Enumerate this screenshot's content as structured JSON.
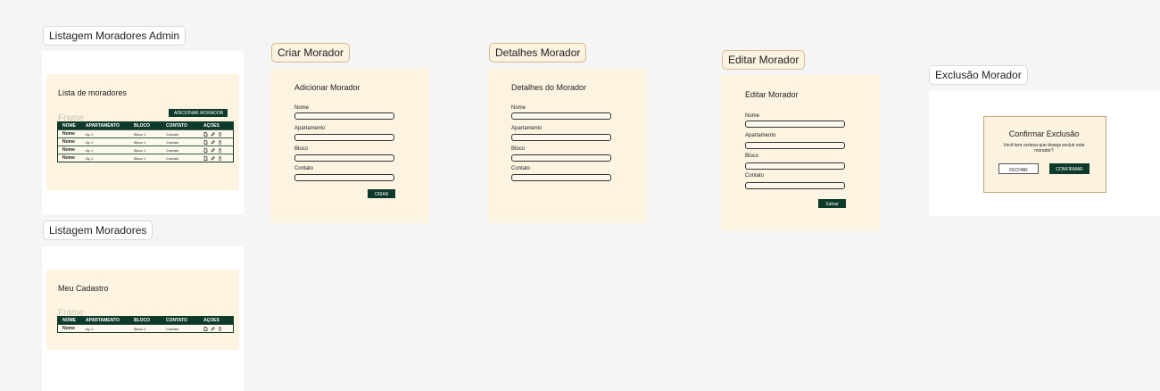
{
  "frames": {
    "admin_list": "Listagem Moradores Admin",
    "create": "Criar Morador",
    "details": "Detalhes Morador",
    "edit": "Editar Morador",
    "delete": "Exclusão Morador",
    "user_list": "Listagem Moradores"
  },
  "admin_list": {
    "title": "Lista de moradores",
    "ghost_label": "Frame",
    "add_button": "ADICIONAR MORADOR",
    "columns": [
      "NOME",
      "APARTAMENTO",
      "BLOCO",
      "CONTATO",
      "AÇÕES"
    ],
    "rows": [
      {
        "nome": "Nome",
        "apartamento": "Ap 1",
        "bloco": "Bloco 1",
        "contato": "Contato"
      },
      {
        "nome": "Nome",
        "apartamento": "Ap 1",
        "bloco": "Bloco 1",
        "contato": "Contato"
      },
      {
        "nome": "Nome",
        "apartamento": "Ap 1",
        "bloco": "Bloco 1",
        "contato": "Contato"
      },
      {
        "nome": "Nome",
        "apartamento": "Ap 1",
        "bloco": "Bloco 1",
        "contato": "Contato"
      }
    ]
  },
  "create": {
    "title": "Adicionar Morador",
    "fields": [
      "Nome",
      "Apartamento",
      "Bloco",
      "Contato"
    ],
    "submit": "CRIAR"
  },
  "details": {
    "title": "Detalhes do Morador",
    "fields": [
      "Nome",
      "Apartamento",
      "Bloco",
      "Contato"
    ]
  },
  "edit": {
    "title": "Editar Morador",
    "fields": [
      "Nome",
      "Apartamento",
      "Bloco",
      "Contato"
    ],
    "submit": "Salvar"
  },
  "delete": {
    "title": "Confirmar Exclusão",
    "message": "Você tem certeza que deseja excluir este morador?",
    "close": "FECHAR",
    "confirm": "CONFIRMAR"
  },
  "user_list": {
    "title": "Meu Cadastro",
    "ghost_label": "Frame",
    "columns": [
      "NOME",
      "APARTAMENTO",
      "BLOCO",
      "CONTATO",
      "AÇÕES"
    ],
    "rows": [
      {
        "nome": "Nome",
        "apartamento": "Ap 1",
        "bloco": "Bloco 1",
        "contato": "Contato"
      }
    ]
  },
  "colors": {
    "accent": "#0e3b29",
    "panel": "#fdf3e1",
    "label_warm": "#fbf2e0"
  }
}
